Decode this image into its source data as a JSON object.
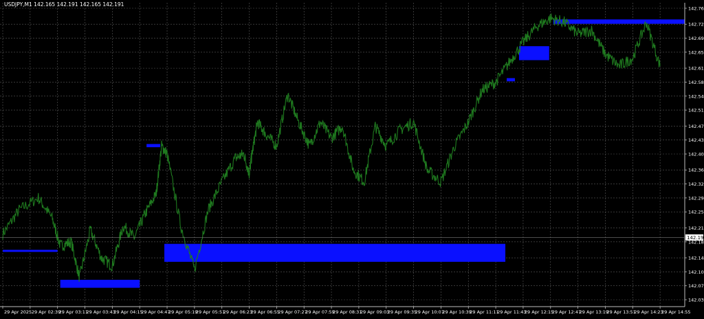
{
  "window": {
    "header_text": "USDJPY,M1  142.165 142.191 142.165 142.191"
  },
  "colors": {
    "background": "#000000",
    "grid": "#5a5a5a",
    "axis": "#c0c0c0",
    "text": "#ffffff",
    "price_line": "#1f7a1f",
    "zones": "#0a10ff",
    "current_price_bg": "#ffffff",
    "current_price_text": "#000000"
  },
  "chart_data": {
    "type": "line",
    "symbol": "USDJPY",
    "timeframe": "M1",
    "ohlc_header": {
      "open": 142.165,
      "high": 142.191,
      "low": 142.165,
      "close": 142.191
    },
    "ylim": [
      142.035,
      142.765
    ],
    "y_ticks": [
      "142.765",
      "142.725",
      "142.690",
      "142.655",
      "142.615",
      "142.580",
      "142.545",
      "142.510",
      "142.470",
      "142.435",
      "142.400",
      "142.360",
      "142.325",
      "142.290",
      "142.255",
      "142.215",
      "142.180",
      "142.140",
      "142.105",
      "142.070",
      "142.035"
    ],
    "x_ticks": [
      "29 Apr 2025",
      "29 Apr 02:39",
      "29 Apr 03:11",
      "29 Apr 03:43",
      "29 Apr 04:15",
      "29 Apr 04:47",
      "29 Apr 05:19",
      "29 Apr 05:51",
      "29 Apr 06:23",
      "29 Apr 06:55",
      "29 Apr 07:27",
      "29 Apr 07:59",
      "29 Apr 08:31",
      "29 Apr 09:03",
      "29 Apr 09:35",
      "29 Apr 10:07",
      "29 Apr 10:39",
      "29 Apr 11:11",
      "29 Apr 11:43",
      "29 Apr 12:15",
      "29 Apr 12:47",
      "29 Apr 13:19",
      "29 Apr 13:51",
      "29 Apr 14:23",
      "29 Apr 14:55"
    ],
    "current_price_label": "142.191",
    "current_price": 142.191,
    "series": [
      {
        "x": [
          0,
          0.6,
          1.3,
          1.8,
          2.1,
          2.5,
          2.8,
          3.2,
          3.6,
          4.0,
          4.4,
          4.8,
          5.2,
          5.6,
          5.8,
          6.0,
          6.5,
          7.0,
          7.5,
          8.0,
          8.5,
          8.8,
          9.0,
          9.1,
          9.3,
          9.6,
          10.0,
          10.4,
          10.8,
          11.2,
          11.6,
          12.0,
          12.4,
          12.8,
          13.2,
          13.6,
          14.0,
          14.5,
          15.0,
          15.5,
          16.0,
          16.5,
          17.0,
          17.5,
          18.0,
          18.5,
          19.0,
          19.5,
          20.0,
          20.5,
          21.0,
          21.5,
          22.0,
          22.5,
          23.0,
          23.5,
          24.0
        ],
        "y": [
          142.2,
          142.26,
          142.29,
          142.24,
          142.17,
          142.18,
          142.09,
          142.21,
          142.14,
          142.12,
          142.22,
          142.19,
          142.25,
          142.3,
          142.42,
          142.4,
          142.22,
          142.11,
          142.26,
          142.33,
          142.39,
          142.4,
          142.35,
          142.4,
          142.48,
          142.45,
          142.42,
          142.55,
          142.48,
          142.42,
          142.48,
          142.44,
          142.47,
          142.36,
          142.33,
          142.47,
          142.42,
          142.46,
          142.48,
          142.36,
          142.33,
          142.42,
          142.48,
          142.56,
          142.58,
          142.63,
          142.68,
          142.72,
          142.74,
          142.73,
          142.7,
          142.71,
          142.65,
          142.62,
          142.64,
          142.73,
          142.62
        ]
      }
    ],
    "zones": [
      {
        "x0": 0.0,
        "x1": 2.0,
        "y_top": 142.16,
        "y_bottom": 142.155
      },
      {
        "x0": 2.1,
        "x1": 5.0,
        "y_top": 142.085,
        "y_bottom": 142.065
      },
      {
        "x0": 5.25,
        "x1": 5.75,
        "y_top": 142.425,
        "y_bottom": 142.417
      },
      {
        "x0": 5.9,
        "x1": 18.35,
        "y_top": 142.175,
        "y_bottom": 142.13
      },
      {
        "x0": 18.4,
        "x1": 18.7,
        "y_top": 142.59,
        "y_bottom": 142.582
      },
      {
        "x0": 18.85,
        "x1": 19.95,
        "y_top": 142.67,
        "y_bottom": 142.635
      },
      {
        "x0": 20.1,
        "x1": 24.9,
        "y_top": 142.737,
        "y_bottom": 142.726
      }
    ]
  }
}
